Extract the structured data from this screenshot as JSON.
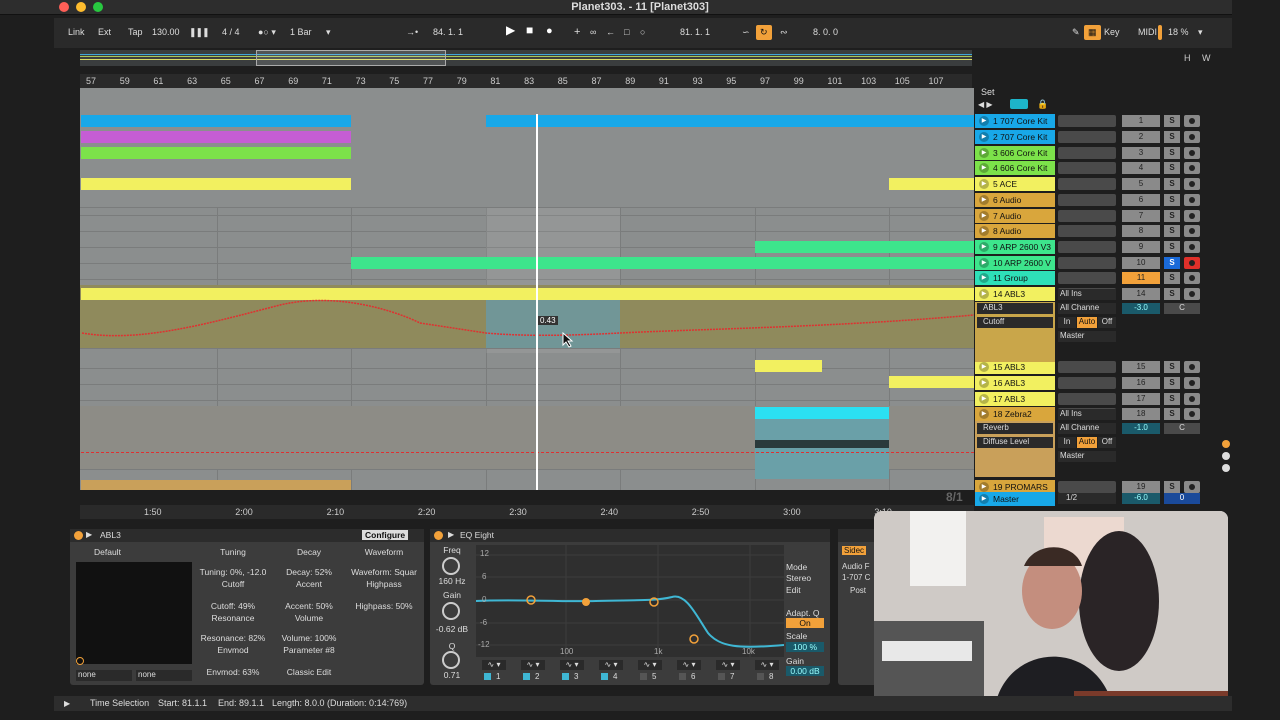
{
  "window": {
    "title": "Planet303. - 11  [Planet303]"
  },
  "transport": {
    "link": "Link",
    "ext": "Ext",
    "tap": "Tap",
    "tempo": "130.00",
    "time_sig": "4 / 4",
    "quantize": "1 Bar",
    "position": "84.  1.  1",
    "loop_start": "81.  1.  1",
    "loop_length": "8.  0.  0",
    "key": "Key",
    "midi": "MIDI",
    "cpu": "18 %"
  },
  "overview": {
    "h": "H",
    "w": "W"
  },
  "ruler": {
    "bars": [
      "57",
      "59",
      "61",
      "63",
      "65",
      "67",
      "69",
      "71",
      "73",
      "75",
      "77",
      "79",
      "81",
      "83",
      "85",
      "87",
      "89",
      "91",
      "93",
      "95",
      "97",
      "99",
      "101",
      "103",
      "105",
      "107"
    ]
  },
  "timeline": {
    "marks": [
      "1:50",
      "2:00",
      "2:10",
      "2:20",
      "2:30",
      "2:40",
      "2:50",
      "3:00",
      "3:10"
    ],
    "page": "8/1"
  },
  "automation": {
    "value": "0.43"
  },
  "set_label": "Set",
  "tracks": [
    {
      "name": "1 707 Core Kit",
      "color": "#18a8e8",
      "num": "1"
    },
    {
      "name": "2 707 Core Kit",
      "color": "#18a8e8",
      "num": "2"
    },
    {
      "name": "3 606 Core Kit",
      "color": "#7ce24a",
      "num": "3"
    },
    {
      "name": "4 606 Core Kit",
      "color": "#7ce24a",
      "num": "4"
    },
    {
      "name": "5 ACE",
      "color": "#f2f060",
      "num": "5"
    },
    {
      "name": "6 Audio",
      "color": "#d9a63c",
      "num": "6"
    },
    {
      "name": "7 Audio",
      "color": "#d9a63c",
      "num": "7"
    },
    {
      "name": "8 Audio",
      "color": "#d9a63c",
      "num": "8"
    },
    {
      "name": "9 ARP 2600 V3",
      "color": "#3de58c",
      "num": "9"
    },
    {
      "name": "10 ARP 2600 V",
      "color": "#3de58c",
      "num": "10"
    },
    {
      "name": "11 Group",
      "color": "#2ee0b8",
      "num": "11"
    },
    {
      "name": "14 ABL3",
      "color": "#f2f060",
      "num": "14"
    },
    {
      "name": "15 ABL3",
      "color": "#f2f060",
      "num": "15"
    },
    {
      "name": "16 ABL3",
      "color": "#f2f060",
      "num": "16"
    },
    {
      "name": "17 ABL3",
      "color": "#f2f060",
      "num": "17"
    },
    {
      "name": "18 Zebra2",
      "color": "#d9a63c",
      "num": "18"
    },
    {
      "name": "19 PROMARS",
      "color": "#d9a63c",
      "num": "19"
    },
    {
      "name": "Master",
      "color": "#18a8e8",
      "num": "0"
    }
  ],
  "abl3_track": {
    "device": "ABL3",
    "param": "Cutoff",
    "input": "All Ins",
    "channel": "All Channe",
    "in": "In",
    "auto": "Auto",
    "off": "Off",
    "out": "Master",
    "vol": "-3.0",
    "pan": "C"
  },
  "zebra_track": {
    "device": "Reverb",
    "param": "Diffuse Level",
    "input": "All Ins",
    "channel": "All Channe",
    "in": "In",
    "auto": "Auto",
    "off": "Off",
    "out": "Master",
    "vol": "-1.0",
    "pan": "C"
  },
  "master_track": {
    "fraction": "1/2",
    "vol": "-6.0",
    "pan": "0"
  },
  "mixer_labels": {
    "s": "S"
  },
  "device_abl3": {
    "title": "ABL3",
    "preset": "Default",
    "configure": "Configure",
    "params": {
      "tuning_h": "Tuning",
      "tuning_v": "Tuning: 0%, -12.0",
      "decay_h": "Decay",
      "decay_v": "Decay: 52%",
      "waveform_h": "Waveform",
      "waveform_v": "Waveform: Squar",
      "cutoff_h": "Cutoff",
      "cutoff_v": "Cutoff: 49%",
      "accent_h": "Accent",
      "accent_v": "Accent: 50%",
      "highpass_h": "Highpass",
      "highpass_v": "Highpass: 50%",
      "resonance_h": "Resonance",
      "resonance_v": "Resonance: 82%",
      "volume_h": "Volume",
      "volume_v": "Volume: 100%",
      "envmod_h": "Envmod",
      "envmod_v": "Envmod: 63%",
      "param8": "Parameter #8",
      "classic": "Classic Edit"
    },
    "none1": "none",
    "none2": "none"
  },
  "device_eq": {
    "title": "EQ Eight",
    "freq_label": "Freq",
    "freq": "160 Hz",
    "gain_label": "Gain",
    "gain": "-0.62 dB",
    "q_label": "Q",
    "q": "0.71",
    "mode_label": "Mode",
    "mode": "Stereo",
    "edit": "Edit",
    "adapt": "Adapt. Q",
    "on": "On",
    "scale_label": "Scale",
    "scale": "100 %",
    "gain2_label": "Gain",
    "gain2": "0.00 dB",
    "db_ticks": [
      "12",
      "6",
      "0",
      "-6",
      "-12"
    ],
    "freq_ticks": [
      "100",
      "1k",
      "10k"
    ],
    "bands": [
      "1",
      "2",
      "3",
      "4",
      "5",
      "6",
      "7",
      "8"
    ]
  },
  "device_side": {
    "sidechain": "Sidec",
    "audio_from": "Audio F",
    "src": "1-707 C",
    "post": "Post"
  },
  "status": {
    "mode": "Time Selection",
    "start": "Start: 81.1.1",
    "end": "End: 89.1.1",
    "length": "Length: 8.0.0 (Duration: 0:14:769)"
  }
}
